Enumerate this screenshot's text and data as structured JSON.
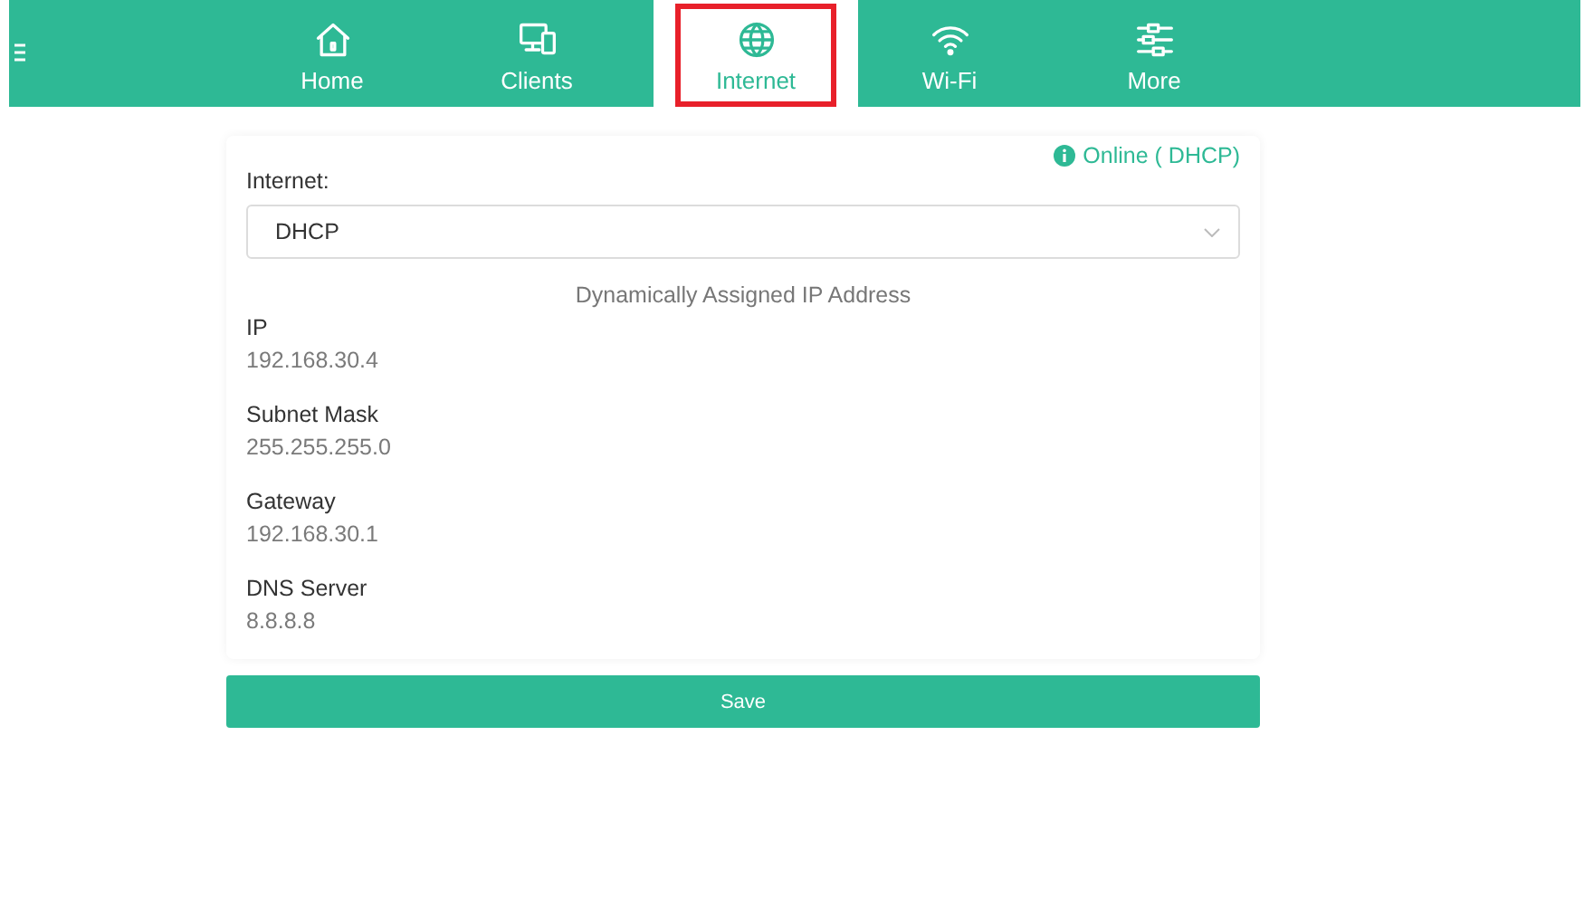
{
  "nav": {
    "tabs": [
      {
        "label": "Home",
        "kind": "home",
        "selected": false
      },
      {
        "label": "Clients",
        "kind": "clients",
        "selected": false
      },
      {
        "label": "Internet",
        "kind": "globe",
        "selected": true
      },
      {
        "label": "Wi-Fi",
        "kind": "wifi",
        "selected": false
      },
      {
        "label": "More",
        "kind": "sliders",
        "selected": false
      }
    ]
  },
  "status": "Online ( DHCP)",
  "internet": {
    "label": "Internet:",
    "value": "DHCP"
  },
  "section_title": "Dynamically Assigned IP Address",
  "fields": [
    {
      "label": "IP",
      "value": "192.168.30.4"
    },
    {
      "label": "Subnet Mask",
      "value": "255.255.255.0"
    },
    {
      "label": "Gateway",
      "value": "192.168.30.1"
    },
    {
      "label": "DNS Server",
      "value": "8.8.8.8"
    }
  ],
  "save_button": "Save"
}
